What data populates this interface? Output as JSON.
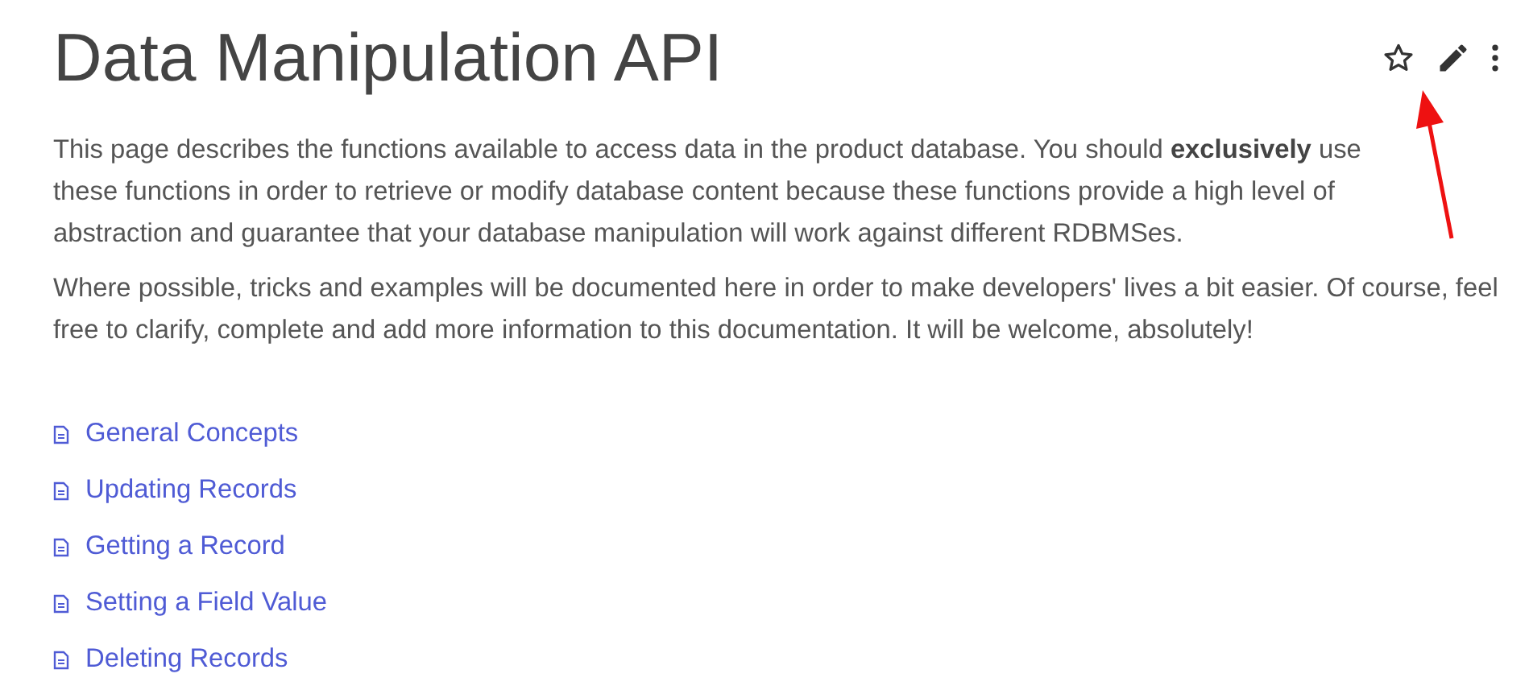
{
  "title": "Data Manipulation API",
  "paragraphs": [
    "This page describes the functions available to access data in the product database. You should **exclusively** use these functions in order to retrieve or modify database content because these functions provide a high level of abstraction and guarantee that your database manipulation will work against different RDBMSes.",
    "Where possible, tricks and examples will be documented here in order to make developers' lives a bit easier. Of course, feel free to clarify, complete and add more information to this documentation. It will be welcome, absolutely!"
  ],
  "links": [
    "General Concepts",
    "Updating Records",
    "Getting a Record",
    "Setting a Field Value",
    "Deleting Records"
  ]
}
